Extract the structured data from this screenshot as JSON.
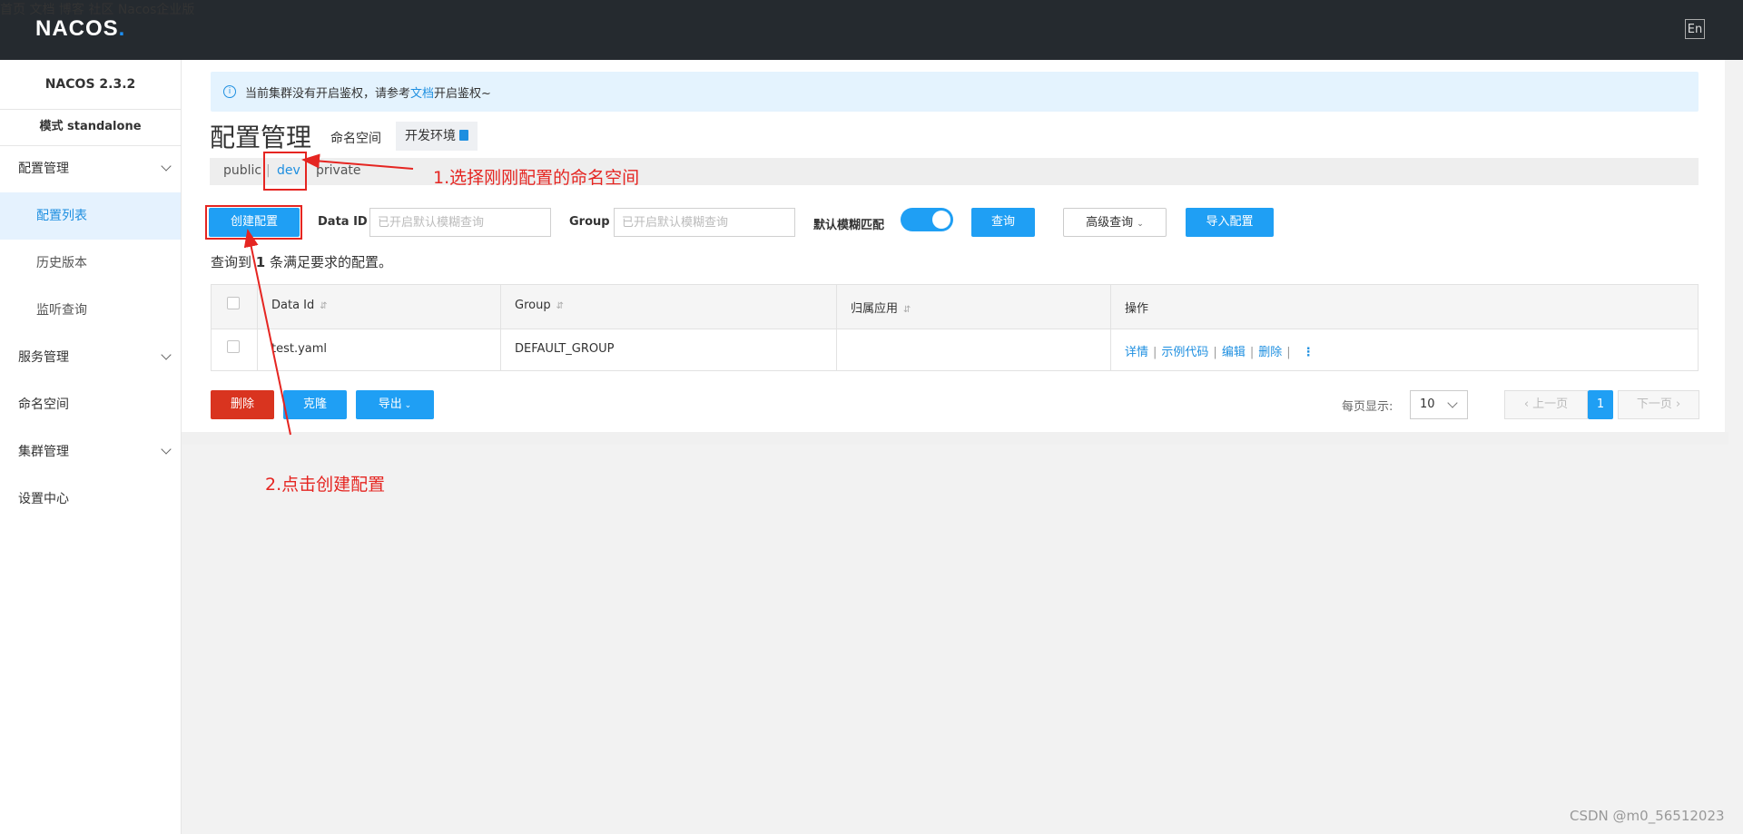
{
  "header": {
    "logo": "NACOS",
    "logo_dot": ".",
    "nav": [
      "首页",
      "文档",
      "博客",
      "社区",
      "Nacos企业版"
    ],
    "lang": "En"
  },
  "sidebar": {
    "version": "NACOS 2.3.2",
    "mode": "模式 standalone",
    "items": [
      {
        "label": "配置管理"
      },
      {
        "label": "配置列表"
      },
      {
        "label": "历史版本"
      },
      {
        "label": "监听查询"
      },
      {
        "label": "服务管理"
      },
      {
        "label": "命名空间"
      },
      {
        "label": "集群管理"
      },
      {
        "label": "设置中心"
      }
    ]
  },
  "notice": {
    "before": "当前集群没有开启鉴权，请参考",
    "link": "文档",
    "after": "开启鉴权~"
  },
  "page": {
    "title": "配置管理",
    "namespace_label": "命名空间",
    "current_env": "开发环境"
  },
  "namespaces": [
    "public",
    "dev",
    "private"
  ],
  "namespace_separator": "|",
  "toolbar": {
    "create": "创建配置",
    "data_id_label": "Data ID",
    "data_id_placeholder": "已开启默认模糊查询",
    "group_label": "Group",
    "group_placeholder": "已开启默认模糊查询",
    "fuzzy_label": "默认模糊匹配",
    "fuzzy_on": true,
    "search": "查询",
    "advanced": "高级查询",
    "import": "导入配置"
  },
  "result": {
    "prefix": "查询到",
    "count": "1",
    "suffix": "条满足要求的配置。"
  },
  "table": {
    "headers": [
      "Data Id",
      "Group",
      "归属应用",
      "操作"
    ],
    "sort_mark": "⇵",
    "rows": [
      {
        "data_id": "test.yaml",
        "group": "DEFAULT_GROUP",
        "app": "",
        "actions": [
          "详情",
          "示例代码",
          "编辑",
          "删除"
        ]
      }
    ]
  },
  "bottom": {
    "delete": "删除",
    "clone": "克隆",
    "export": "导出"
  },
  "pager": {
    "label": "每页显示:",
    "page_size": "10",
    "prev": "上一页",
    "current": "1",
    "next": "下一页"
  },
  "annotations": {
    "step1": "1.选择刚刚配置的命名空间",
    "step2": "2.点击创建配置",
    "color": "#e52521"
  },
  "watermark": "CSDN @m0_56512023"
}
